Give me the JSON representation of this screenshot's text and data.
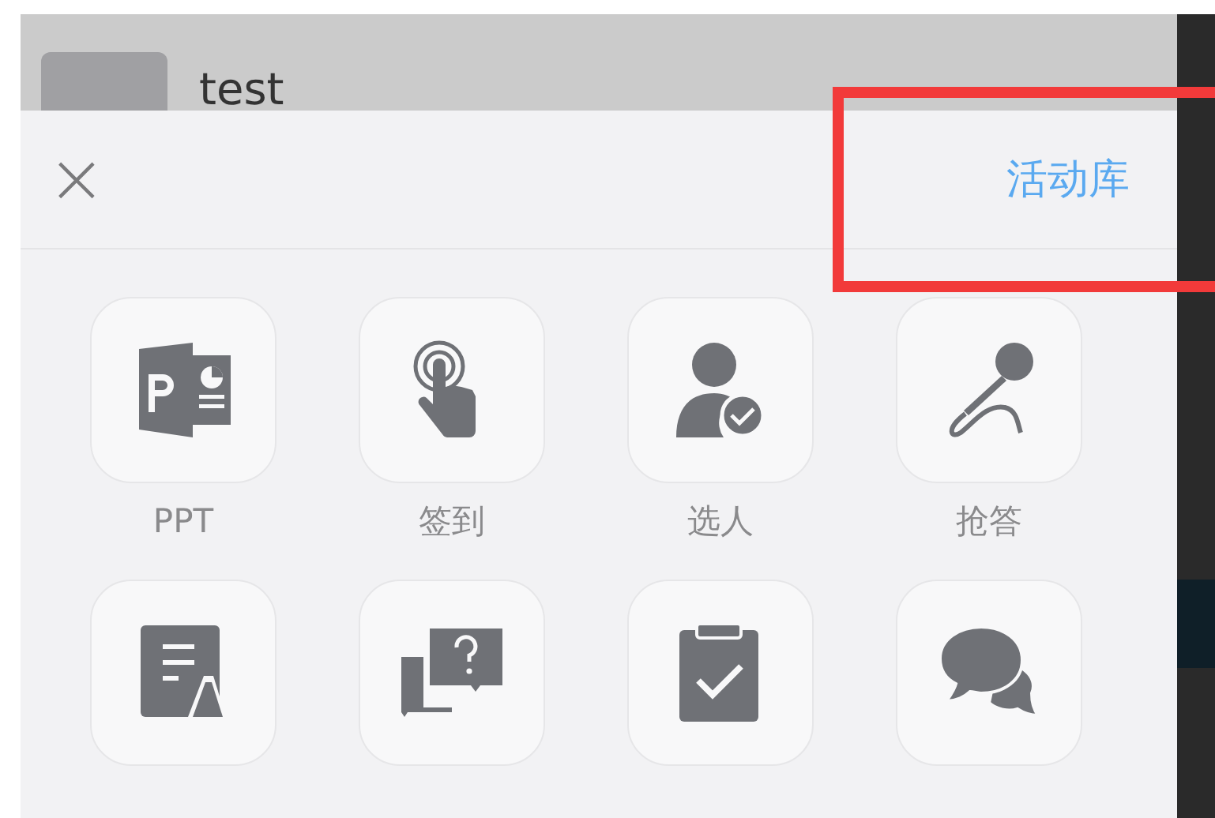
{
  "background": {
    "title": "test"
  },
  "sheet": {
    "close": "×",
    "library_link": "活动库",
    "highlighted": true,
    "items": [
      {
        "kind": "ppt",
        "label": "PPT"
      },
      {
        "kind": "tap",
        "label": "签到"
      },
      {
        "kind": "person",
        "label": "选人"
      },
      {
        "kind": "mic",
        "label": "抢答"
      },
      {
        "kind": "list"
      },
      {
        "kind": "question"
      },
      {
        "kind": "clipboard"
      },
      {
        "kind": "chat"
      }
    ]
  }
}
